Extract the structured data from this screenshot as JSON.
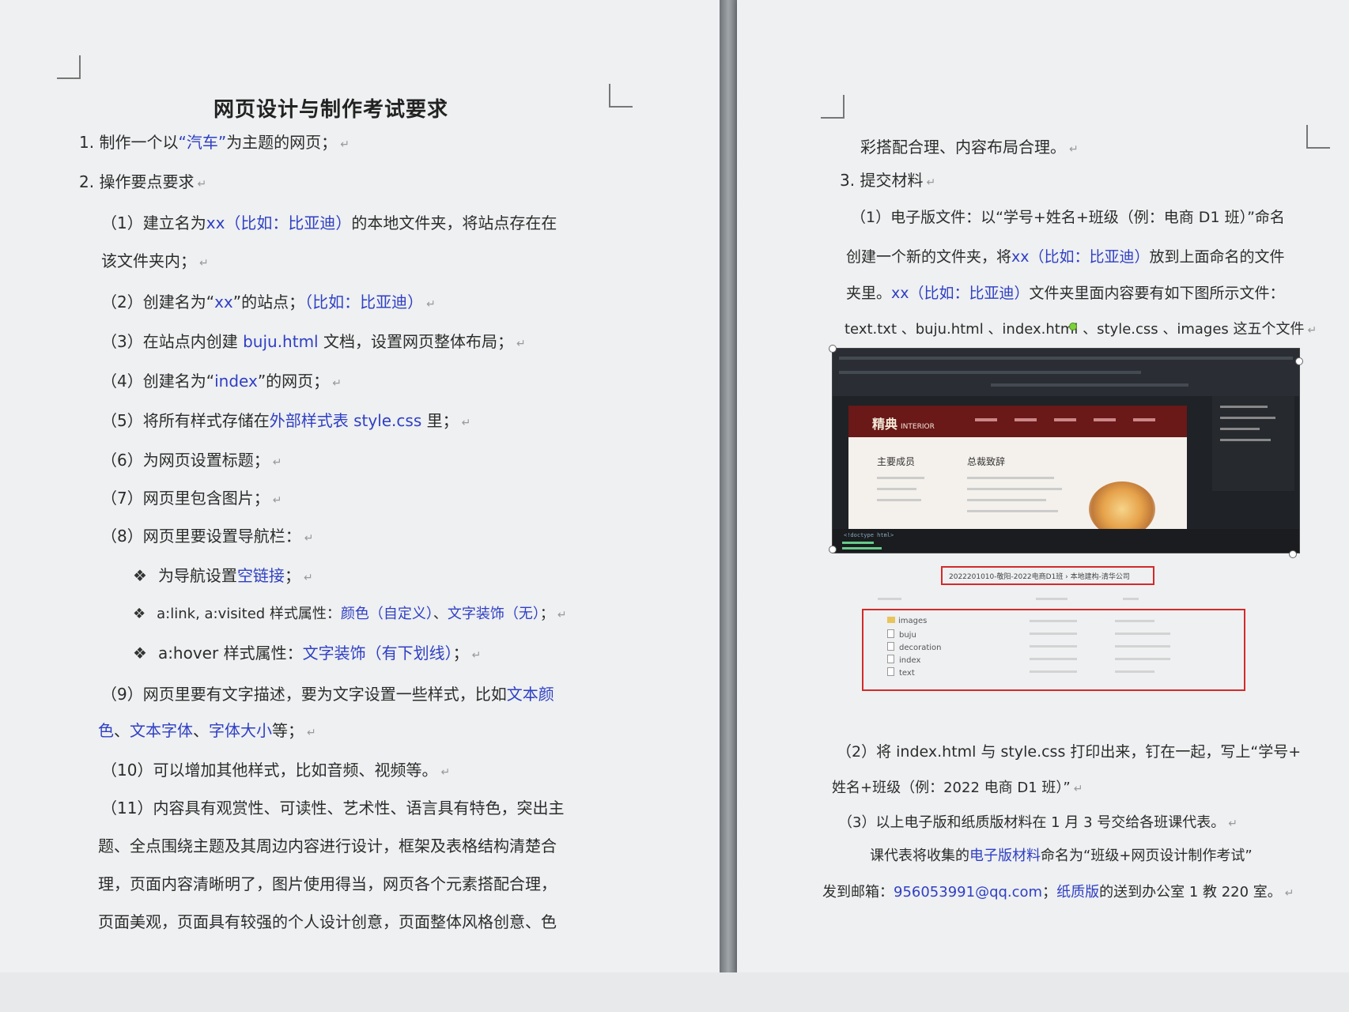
{
  "left_page": {
    "title": "网页设计与制作考试要求",
    "item1": {
      "prefix": "1. 制作一个以",
      "highlight": "“汽车”",
      "suffix": "为主题的网页；"
    },
    "item2": "2. 操作要点要求",
    "sub1a": {
      "prefix": "（1）建立名为",
      "highlight": "xx（比如：比亚迪）",
      "suffix": "的本地文件夹，将站点存在在"
    },
    "sub1b": "该文件夹内；",
    "sub2": {
      "prefix": "（2）创建名为“",
      "highlight1": "xx",
      "middle": "”的站点；",
      "highlight2": "（比如：比亚迪）"
    },
    "sub3": {
      "prefix": "（3）在站点内创建",
      "highlight": "buju.html",
      "suffix": "文档，设置网页整体布局；"
    },
    "sub4": {
      "prefix": "（4）创建名为“",
      "highlight": "index",
      "suffix": "”的网页；"
    },
    "sub5": {
      "prefix": "（5）将所有样式存储在",
      "highlight": "外部样式表 style.css",
      "suffix": "里；"
    },
    "sub6": "（6）为网页设置标题；",
    "sub7": "（7）网页里包含图片；",
    "sub8": "（8）网页里要设置导航栏：",
    "bullet1": {
      "symbol": "❖",
      "prefix": "为导航设置",
      "highlight": "空链接",
      "suffix": "；"
    },
    "bullet2": {
      "symbol": "❖",
      "prefix": "a:link, a:visited 样式属性：",
      "highlight1": "颜色（自定义）",
      "sep": "、",
      "highlight2": "文字装饰（无）",
      "suffix": "；"
    },
    "bullet3": {
      "symbol": "❖",
      "prefix": "a:hover 样式属性：",
      "highlight": "文字装饰（有下划线）",
      "suffix": "；"
    },
    "sub9a": {
      "prefix": "（9）网页里要有文字描述，要为文字设置一些样式，比如",
      "highlight": "文本颜"
    },
    "sub9b": {
      "h1": "色",
      "s1": "、",
      "h2": "文本字体",
      "s2": "、",
      "h3": "字体大小",
      "suffix": "等；"
    },
    "sub10": "（10）可以增加其他样式，比如音频、视频等。",
    "sub11a": "（11）内容具有观赏性、可读性、艺术性、语言具有特色，突出主",
    "sub11b": "题、全点围绕主题及其周边内容进行设计，框架及表格结构清楚合",
    "sub11c": "理，页面内容清晰明了，图片使用得当，网页各个元素搭配合理，",
    "sub11d": "页面美观，页面具有较强的个人设计创意，页面整体风格创意、色"
  },
  "right_page": {
    "cont": "彩搭配合理、内容布局合理。",
    "item3": "3. 提交材料",
    "e1a": "（1）电子版文件：以“学号+姓名+班级（例：电商 D1 班）”命名",
    "e1b": {
      "prefix": "创建一个新的文件夹，将",
      "highlight": "xx（比如：比亚迪）",
      "suffix": "放到上面命名的文件"
    },
    "e1c": {
      "prefix": "夹里。",
      "highlight": "xx（比如：比亚迪）",
      "suffix": "文件夹里面内容要有如下图所示文件："
    },
    "e1d": "text.txt 、buju.html 、index.html 、style.css 、images 这五个文件",
    "figure": {
      "brand": "精典",
      "brand_sub": "INTERIOR",
      "heading1": "主要成员",
      "heading2": "总裁致辞",
      "code_line": "<!doctype html>",
      "address_bar": "2022201010-敬阳-2022电商D1班 › 本地建构-清华公司",
      "files": [
        "images",
        "buju",
        "decoration",
        "index",
        "text"
      ]
    },
    "e2a": "（2）将 index.html 与 style.css 打印出来，钉在一起，写上“学号+",
    "e2b": "姓名+班级（例：2022 电商 D1 班）”",
    "e3": "（3）以上电子版和纸质版材料在 1 月 3 号交给各班课代表。",
    "e4a": {
      "prefix": "课代表将收集的",
      "highlight": "电子版材料",
      "suffix": "命名为“班级+网页设计制作考试”"
    },
    "e4b": {
      "prefix": "发到邮箱：",
      "email": "956053991@qq.com",
      "sep": "；",
      "highlight": "纸质版",
      "suffix": "的送到办公室 1 教 220 室。"
    }
  },
  "colors": {
    "link_blue": "#2f3fc4",
    "red_box": "#d42a2a",
    "page": "#eef0f1"
  }
}
